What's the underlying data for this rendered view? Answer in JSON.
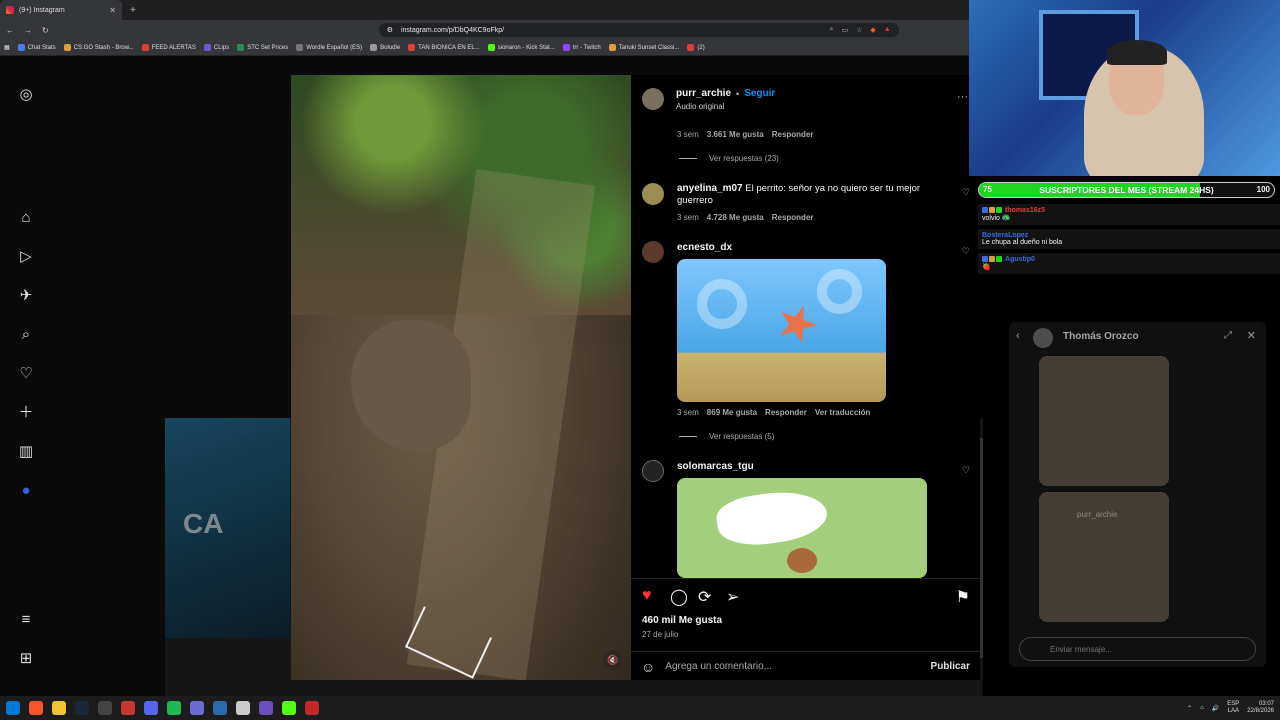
{
  "browser": {
    "tab_title": "(9+) Instagram",
    "url": "instagram.com/p/DbQ4KC9oFkp/",
    "bookmarks": [
      "Chat Stats",
      "CS:GO Stash - Brow...",
      "FEED ALERTAS",
      "CLips",
      "STC Set Prices",
      "Wordle Español (ES)",
      "Boludle",
      "TAN BIONICA EN EL...",
      "sionaron - Kick Stat...",
      "trr - Twitch",
      "Tanuki Sunset Classi...",
      "(2)"
    ]
  },
  "post": {
    "author": "purr_archie",
    "follow_label": "Seguir",
    "audio": "Audio original",
    "likes": "460 mil Me gusta",
    "date": "27 de julio",
    "add_comment_placeholder": "Agrega un comentario...",
    "publish_label": "Publicar"
  },
  "comments": [
    {
      "partial": true,
      "time": "3 sem",
      "likes": "3.661 Me gusta",
      "reply": "Responder",
      "view_replies": "Ver respuestas (23)"
    },
    {
      "user": "anyelina_m07",
      "text": "El perrito: señor ya no quiero ser tu mejor guerrero",
      "time": "3 sem",
      "likes": "4.728 Me gusta",
      "reply": "Responder"
    },
    {
      "user": "ecnesto_dx",
      "time": "3 sem",
      "likes": "869 Me gusta",
      "reply": "Responder",
      "translate": "Ver traducción",
      "view_replies": "Ver respuestas (5)"
    },
    {
      "user": "solomarcas_tgu"
    }
  ],
  "stream": {
    "subgoal": {
      "label": "SUSCRIPTORES DEL MES (STREAM 24HS)",
      "current": "75",
      "goal": "100",
      "progress": 0.75
    },
    "chat": [
      {
        "user": "thomas16z5",
        "color": "#e23b3b",
        "text": "volvio 🦚"
      },
      {
        "user": "BosteraLopez",
        "color": "#3b6ce2",
        "text": "Le chupa al dueño ni bola"
      },
      {
        "user": "Agustip0",
        "color": "#3b6ce2",
        "text": "🍓"
      }
    ],
    "dm": {
      "title": "Thomás Orozco",
      "thumb_label": "purr_archie",
      "input_placeholder": "Enviar mensaje..."
    }
  },
  "taskbar": {
    "lang": "ESP",
    "lang2": "LAA",
    "time": "03:07",
    "date": "22/8/2026"
  },
  "colors": {
    "accent": "#0095f6",
    "like": "#ff3040",
    "progress": "#1dd61d"
  }
}
